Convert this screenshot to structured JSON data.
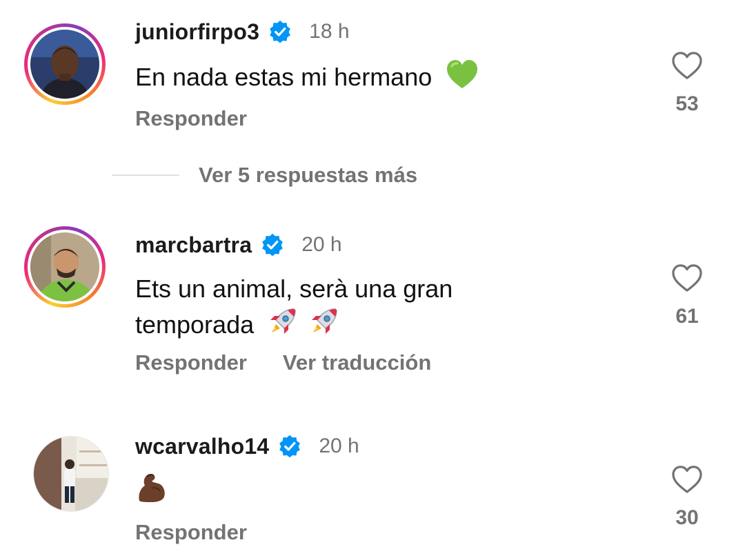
{
  "comments": [
    {
      "username": "juniorfirpo3",
      "time": "18 h",
      "text": "En nada estas mi hermano",
      "text_line2": "",
      "reply_label": "Responder",
      "translate_label": "",
      "likes": "53",
      "has_story_ring": true
    },
    {
      "username": "marcbartra",
      "time": "20 h",
      "text": "Ets un animal, serà una gran",
      "text_line2": "temporada",
      "reply_label": "Responder",
      "translate_label": "Ver traducción",
      "likes": "61",
      "has_story_ring": true
    },
    {
      "username": "wcarvalho14",
      "time": "20 h",
      "text": "",
      "text_line2": "",
      "reply_label": "Responder",
      "translate_label": "",
      "likes": "30",
      "has_story_ring": false
    }
  ],
  "view_replies_label": "Ver 5 respuestas más",
  "icons": {
    "verified": "verified-badge-icon",
    "like": "heart-outline-icon",
    "emoji_heart": "green-heart-emoji",
    "emoji_rocket": "rocket-emoji",
    "emoji_muscle": "flexed-biceps-emoji"
  },
  "colors": {
    "verified_blue": "#0095f6",
    "muted_gray": "#737373",
    "green_heart": "#7ac142"
  }
}
